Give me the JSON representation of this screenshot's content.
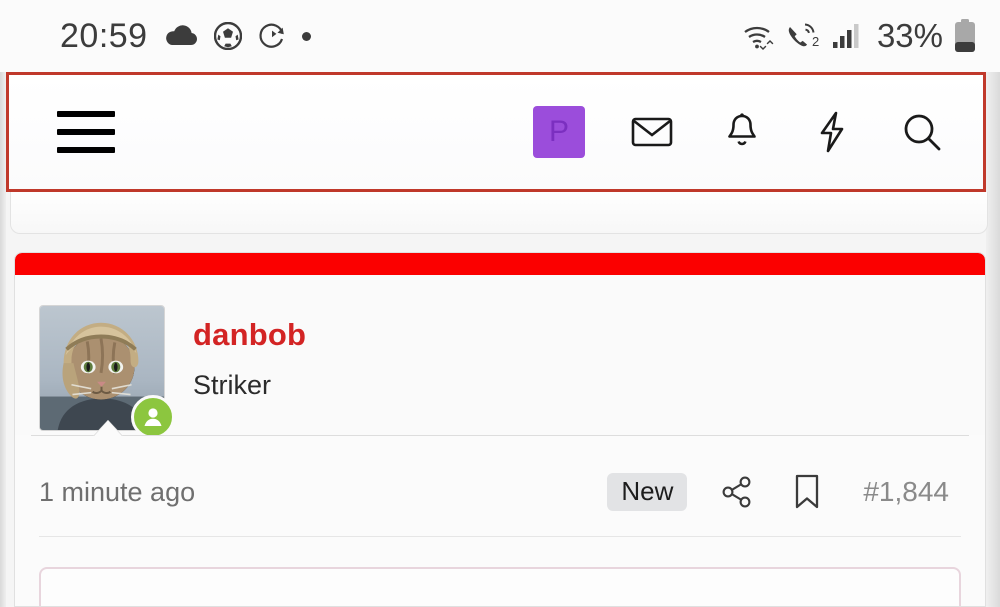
{
  "statusbar": {
    "time": "20:59",
    "battery_percent": "33%",
    "call_badge": "2",
    "icons": [
      "cloud-icon",
      "soccer-ball-icon",
      "sync-circle-icon",
      "dot-icon",
      "wifi-icon",
      "call-icon",
      "signal-bars-icon",
      "battery-icon"
    ]
  },
  "navbar": {
    "menu_label": "hamburger-menu",
    "avatar_letter": "P",
    "avatar_color": "#9b4ddb",
    "actions": [
      {
        "name": "messages",
        "icon": "envelope-icon"
      },
      {
        "name": "alerts",
        "icon": "bell-icon"
      },
      {
        "name": "activity",
        "icon": "lightning-bolt-icon"
      },
      {
        "name": "search",
        "icon": "search-icon"
      }
    ]
  },
  "post": {
    "banner_color": "#fb0000",
    "username": "danbob",
    "username_color": "#d32424",
    "user_title": "Striker",
    "online_status": "online",
    "online_color": "#8cc63f",
    "avatar_alt": "cat-in-pilot-helmet-avatar",
    "timestamp": "1 minute ago",
    "new_badge": "New",
    "post_number": "#1,844",
    "actions": [
      {
        "name": "share",
        "icon": "share-nodes-icon"
      },
      {
        "name": "bookmark",
        "icon": "bookmark-icon"
      }
    ]
  }
}
